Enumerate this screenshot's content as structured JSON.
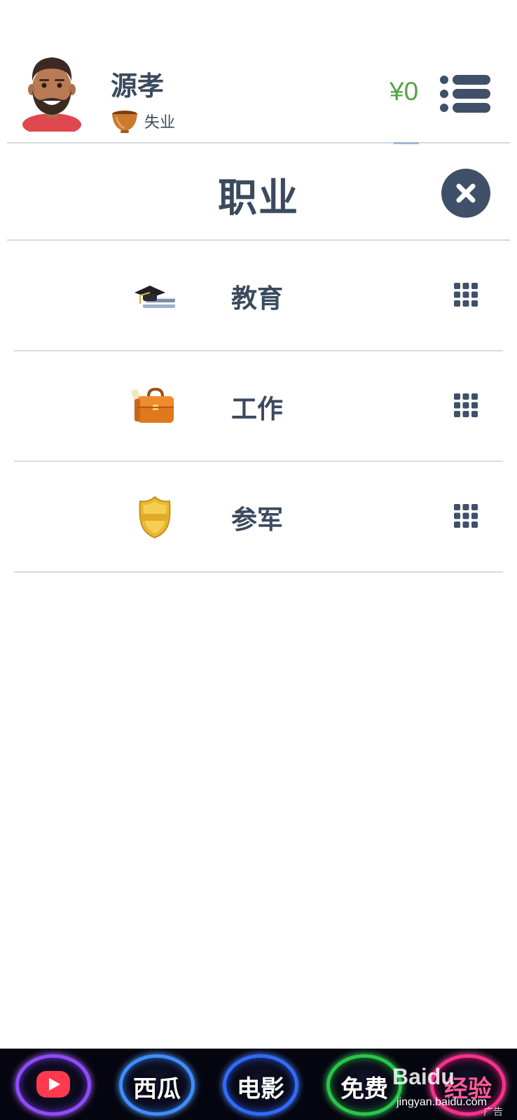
{
  "header": {
    "username": "源孝",
    "status": "失业",
    "balance": "¥0",
    "status_icon": "bowl-icon",
    "menu_icon": "list-menu-icon"
  },
  "panel": {
    "title": "职业",
    "close_icon": "close-icon"
  },
  "careers": [
    {
      "label": "教育",
      "icon": "graduation-cap-icon"
    },
    {
      "label": "工作",
      "icon": "briefcase-icon"
    },
    {
      "label": "参军",
      "icon": "police-badge-icon"
    }
  ],
  "ad_banner": {
    "items": [
      "西瓜",
      "电影",
      "免费",
      "经验"
    ],
    "watermark": "Baidu",
    "watermark_url": "jingyan.baidu.com",
    "ad_tag": "广告"
  },
  "colors": {
    "text": "#3b4a5e",
    "balance": "#58a14a",
    "close_button": "#3f5068",
    "divider": "#d5d8dd"
  }
}
